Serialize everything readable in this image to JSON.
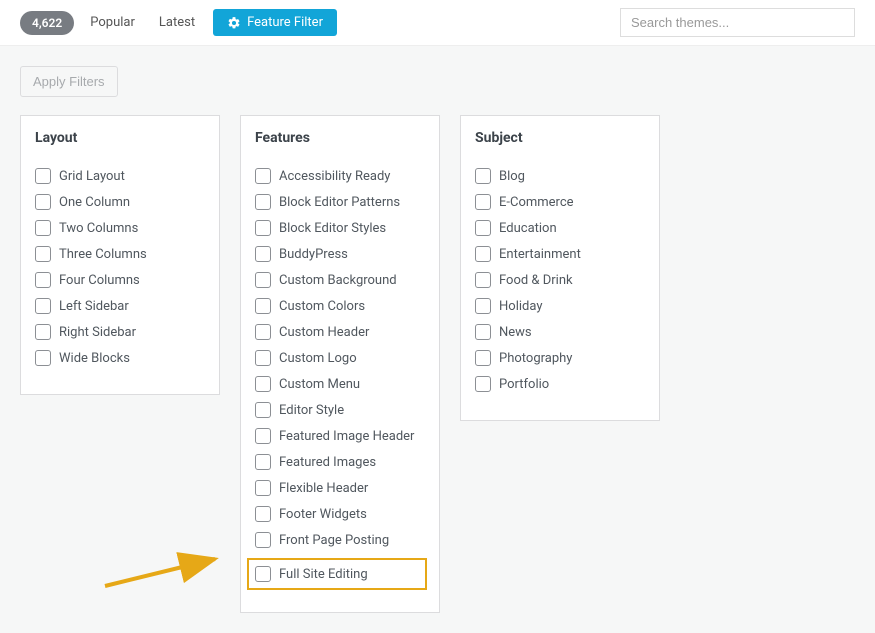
{
  "topbar": {
    "count": "4,622",
    "tabs": {
      "popular": "Popular",
      "latest": "Latest"
    },
    "feature_filter": "Feature Filter",
    "search_placeholder": "Search themes..."
  },
  "apply_button": "Apply Filters",
  "columns": {
    "layout": {
      "title": "Layout",
      "items": [
        "Grid Layout",
        "One Column",
        "Two Columns",
        "Three Columns",
        "Four Columns",
        "Left Sidebar",
        "Right Sidebar",
        "Wide Blocks"
      ]
    },
    "features": {
      "title": "Features",
      "items": [
        "Accessibility Ready",
        "Block Editor Patterns",
        "Block Editor Styles",
        "BuddyPress",
        "Custom Background",
        "Custom Colors",
        "Custom Header",
        "Custom Logo",
        "Custom Menu",
        "Editor Style",
        "Featured Image Header",
        "Featured Images",
        "Flexible Header",
        "Footer Widgets",
        "Front Page Posting",
        "Full Site Editing"
      ]
    },
    "subject": {
      "title": "Subject",
      "items": [
        "Blog",
        "E-Commerce",
        "Education",
        "Entertainment",
        "Food & Drink",
        "Holiday",
        "News",
        "Photography",
        "Portfolio"
      ]
    }
  },
  "highlighted_item": "Full Site Editing"
}
